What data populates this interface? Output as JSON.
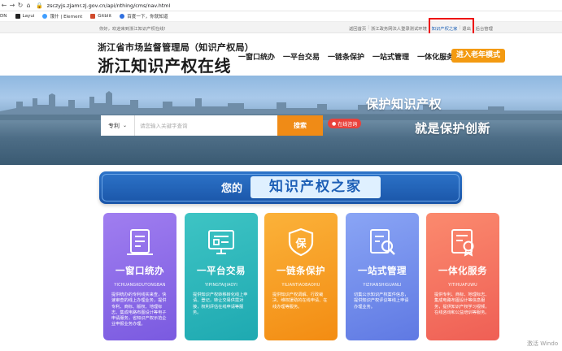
{
  "browser": {
    "url": "zsczyjs.zjamr.zj.gov.cn/api/nthing/cms/nav.html",
    "bookmarks": [
      "DN",
      "Layui",
      "饿什 | Element",
      "Gitblit",
      "百度一下，你就知道"
    ]
  },
  "topbar": {
    "welcome": "你好，欢迎来到浙江知识产权在线!",
    "links": [
      "返回首页",
      "浙江政务网法人登录测试环境",
      "知识产权之家",
      "退出",
      "后台管理"
    ]
  },
  "header": {
    "org": "浙江省市场监督管理局（知识产权局）",
    "site": "浙江知识产权在线",
    "nav": [
      "一窗口统办",
      "一平台交易",
      "一链条保护",
      "一站式管理",
      "一体化服务"
    ],
    "elder_mode": "进入老年模式"
  },
  "banner": {
    "slogan_1": "保护知识产权",
    "slogan_2": "就是保护创新"
  },
  "search": {
    "type": "专利",
    "placeholder": "请您输入关键字查询",
    "button": "搜索",
    "consult": "在线咨询"
  },
  "home": {
    "prefix": "您的",
    "title": "知识产权之家"
  },
  "cards": [
    {
      "title": "一窗口统办",
      "pinyin": "YICHUANGKOUTONGBAN",
      "desc": "提供统办的专利线实来查，快速审查的线上办理业务，提供专利、商标、版权、地理标志、集成电路布图设计等电子申请服务，省知识产权示范企业申报业务办理。",
      "color": "#8c6aea"
    },
    {
      "title": "一平台交易",
      "pinyin": "YIPINGTAIJIAOYI",
      "desc": "提供知识产权转移转化线上申请、登记，转让交易供需对接，权利评估在线申请等服务。",
      "color": "#28b6ba"
    },
    {
      "title": "一链条保护",
      "pinyin": "YILIANTIAOBAOHU",
      "desc": "提供知识产权调解、行政裁决、维权援助的在线申请、在线办理等服务。",
      "color": "#f59c22"
    },
    {
      "title": "一站式管理",
      "pinyin": "YIZHANSHIGUANLI",
      "desc": "切集公示知识产权案件信息，提供知识产权评议等线上申请办理业务。",
      "color": "#7089ec"
    },
    {
      "title": "一体化服务",
      "pinyin": "YITIHUAFUWU",
      "desc": "提供专利、商标、地理标志、集成电路布图设计等信息服务，提供知识产权学习视频，在线咨询和公益培训等服务。",
      "color": "#f5735f"
    }
  ],
  "watermark": "激活 Windo"
}
